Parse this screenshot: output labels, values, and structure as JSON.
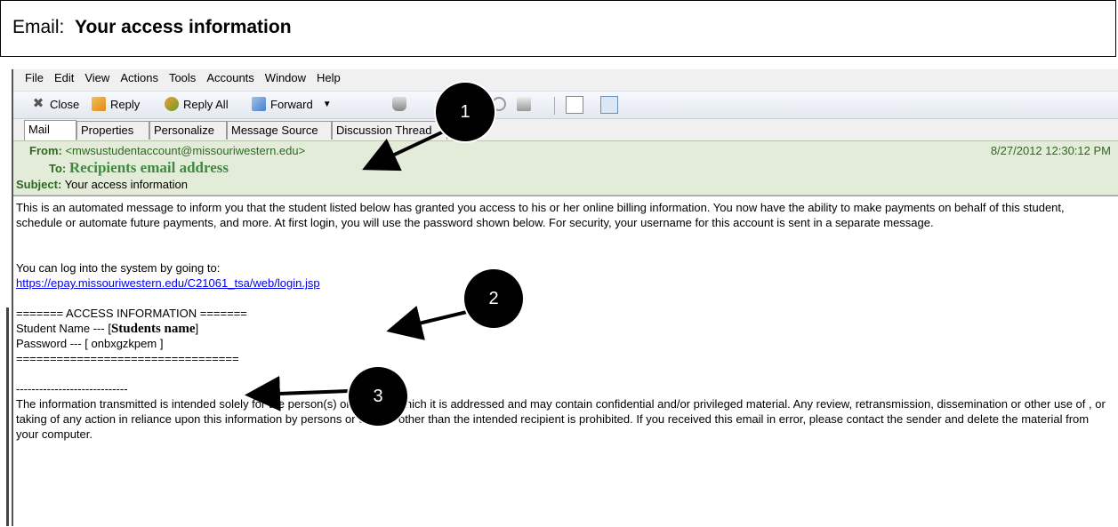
{
  "banner": {
    "prefix": "Email:",
    "title": "Your access information"
  },
  "menu": [
    "File",
    "Edit",
    "View",
    "Actions",
    "Tools",
    "Accounts",
    "Window",
    "Help"
  ],
  "toolbar": {
    "close": "Close",
    "reply": "Reply",
    "reply_all": "Reply All",
    "forward": "Forward"
  },
  "tabs": [
    "Mail",
    "Properties",
    "Personalize",
    "Message Source",
    "Discussion Thread"
  ],
  "header": {
    "from_label": "From:",
    "from_value": "<mwsustudentaccount@missouriwestern.edu>",
    "date": "8/27/2012 12:30:12 PM",
    "to_label": "To:",
    "to_value": "Recipients email address",
    "subject_label": "Subject:",
    "subject_value": "Your access information"
  },
  "body": {
    "para1": "This is an automated message to inform you that the student listed below has granted you access to his or her online billing information.  You now have the ability to make payments on behalf of this student, schedule or automate future payments, and more.  At first login, you will use the password shown below.  For security, your username for this account is sent in a separate message.",
    "login_intro": "You can log into the system by going to:",
    "login_url": "https://epay.missouriwestern.edu/C21061_tsa/web/login.jsp",
    "access_header": "======= ACCESS INFORMATION =======",
    "student_prefix": "Student Name --- [",
    "student_name": "Students name",
    "student_suffix": "]",
    "password_line": "Password --- [ onbxgzkpem ]",
    "rule_line": "=================================",
    "dash_line": "-----------------------------",
    "disclaimer": "The information transmitted is intended solely for the person(s) or entity to which it is addressed and may contain confidential and/or privileged material.  Any review, retransmission, dissemination or other use of , or taking of any action in reliance upon this information by persons or entities other than the intended recipient is prohibited. If you received this email  in error, please contact the sender and delete the material from your computer."
  },
  "callouts": [
    "1",
    "2",
    "3"
  ]
}
